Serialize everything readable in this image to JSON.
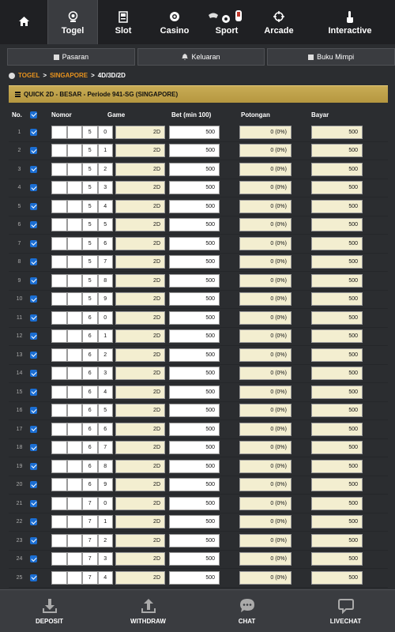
{
  "topnav": {
    "items": [
      {
        "label": "",
        "icon": "home-icon"
      },
      {
        "label": "Togel",
        "icon": "lottery-ball-icon"
      },
      {
        "label": "Slot",
        "icon": "slot-machine-icon"
      },
      {
        "label": "Casino",
        "icon": "casino-chip-icon"
      },
      {
        "label": "Sport",
        "icon": "sport-icon"
      },
      {
        "label": "Arcade",
        "icon": "crosshair-icon"
      },
      {
        "label": "Interactive",
        "icon": "tap-hand-icon"
      }
    ],
    "active": "Togel"
  },
  "subnav": {
    "pasaran": "Pasaran",
    "keluaran": "Keluaran",
    "buku_mimpi": "Buku Mimpi"
  },
  "breadcrumb": {
    "item1": "TOGEL",
    "item2": "SINGAPORE",
    "current": "4D/3D/2D",
    "separator": ">"
  },
  "section": {
    "title": "QUICK 2D - BESAR - Periode 941-SG (SINGAPORE)"
  },
  "table": {
    "headers": {
      "no": "No.",
      "nomor": "Nomor",
      "game": "Game",
      "bet": "Bet (min 100)",
      "potongan": "Potongan",
      "bayar": "Bayar"
    },
    "rows": [
      {
        "no": "1",
        "d3": "5",
        "d4": "0",
        "game": "2D",
        "bet": "500",
        "potongan": "0 (0%)",
        "bayar": "500",
        "checked": true
      },
      {
        "no": "2",
        "d3": "5",
        "d4": "1",
        "game": "2D",
        "bet": "500",
        "potongan": "0 (0%)",
        "bayar": "500",
        "checked": true
      },
      {
        "no": "3",
        "d3": "5",
        "d4": "2",
        "game": "2D",
        "bet": "500",
        "potongan": "0 (0%)",
        "bayar": "500",
        "checked": true
      },
      {
        "no": "4",
        "d3": "5",
        "d4": "3",
        "game": "2D",
        "bet": "500",
        "potongan": "0 (0%)",
        "bayar": "500",
        "checked": true
      },
      {
        "no": "5",
        "d3": "5",
        "d4": "4",
        "game": "2D",
        "bet": "500",
        "potongan": "0 (0%)",
        "bayar": "500",
        "checked": true
      },
      {
        "no": "6",
        "d3": "5",
        "d4": "5",
        "game": "2D",
        "bet": "500",
        "potongan": "0 (0%)",
        "bayar": "500",
        "checked": true
      },
      {
        "no": "7",
        "d3": "5",
        "d4": "6",
        "game": "2D",
        "bet": "500",
        "potongan": "0 (0%)",
        "bayar": "500",
        "checked": true
      },
      {
        "no": "8",
        "d3": "5",
        "d4": "7",
        "game": "2D",
        "bet": "500",
        "potongan": "0 (0%)",
        "bayar": "500",
        "checked": true
      },
      {
        "no": "9",
        "d3": "5",
        "d4": "8",
        "game": "2D",
        "bet": "500",
        "potongan": "0 (0%)",
        "bayar": "500",
        "checked": true
      },
      {
        "no": "10",
        "d3": "5",
        "d4": "9",
        "game": "2D",
        "bet": "500",
        "potongan": "0 (0%)",
        "bayar": "500",
        "checked": true
      },
      {
        "no": "11",
        "d3": "6",
        "d4": "0",
        "game": "2D",
        "bet": "500",
        "potongan": "0 (0%)",
        "bayar": "500",
        "checked": true
      },
      {
        "no": "12",
        "d3": "6",
        "d4": "1",
        "game": "2D",
        "bet": "500",
        "potongan": "0 (0%)",
        "bayar": "500",
        "checked": true
      },
      {
        "no": "13",
        "d3": "6",
        "d4": "2",
        "game": "2D",
        "bet": "500",
        "potongan": "0 (0%)",
        "bayar": "500",
        "checked": true
      },
      {
        "no": "14",
        "d3": "6",
        "d4": "3",
        "game": "2D",
        "bet": "500",
        "potongan": "0 (0%)",
        "bayar": "500",
        "checked": true
      },
      {
        "no": "15",
        "d3": "6",
        "d4": "4",
        "game": "2D",
        "bet": "500",
        "potongan": "0 (0%)",
        "bayar": "500",
        "checked": true
      },
      {
        "no": "16",
        "d3": "6",
        "d4": "5",
        "game": "2D",
        "bet": "500",
        "potongan": "0 (0%)",
        "bayar": "500",
        "checked": true
      },
      {
        "no": "17",
        "d3": "6",
        "d4": "6",
        "game": "2D",
        "bet": "500",
        "potongan": "0 (0%)",
        "bayar": "500",
        "checked": true
      },
      {
        "no": "18",
        "d3": "6",
        "d4": "7",
        "game": "2D",
        "bet": "500",
        "potongan": "0 (0%)",
        "bayar": "500",
        "checked": true
      },
      {
        "no": "19",
        "d3": "6",
        "d4": "8",
        "game": "2D",
        "bet": "500",
        "potongan": "0 (0%)",
        "bayar": "500",
        "checked": true
      },
      {
        "no": "20",
        "d3": "6",
        "d4": "9",
        "game": "2D",
        "bet": "500",
        "potongan": "0 (0%)",
        "bayar": "500",
        "checked": true
      },
      {
        "no": "21",
        "d3": "7",
        "d4": "0",
        "game": "2D",
        "bet": "500",
        "potongan": "0 (0%)",
        "bayar": "500",
        "checked": true
      },
      {
        "no": "22",
        "d3": "7",
        "d4": "1",
        "game": "2D",
        "bet": "500",
        "potongan": "0 (0%)",
        "bayar": "500",
        "checked": true
      },
      {
        "no": "23",
        "d3": "7",
        "d4": "2",
        "game": "2D",
        "bet": "500",
        "potongan": "0 (0%)",
        "bayar": "500",
        "checked": true
      },
      {
        "no": "24",
        "d3": "7",
        "d4": "3",
        "game": "2D",
        "bet": "500",
        "potongan": "0 (0%)",
        "bayar": "500",
        "checked": true
      },
      {
        "no": "25",
        "d3": "7",
        "d4": "4",
        "game": "2D",
        "bet": "500",
        "potongan": "0 (0%)",
        "bayar": "500",
        "checked": true
      }
    ]
  },
  "bottombar": {
    "deposit": "DEPOSIT",
    "withdraw": "WITHDRAW",
    "chat": "CHAT",
    "livechat": "LIVECHAT"
  },
  "colors": {
    "accent": "#e8931e",
    "header_gold": "#c8ab55",
    "checkbox": "#1b6ed3",
    "readonly_field": "#f3eed0"
  }
}
